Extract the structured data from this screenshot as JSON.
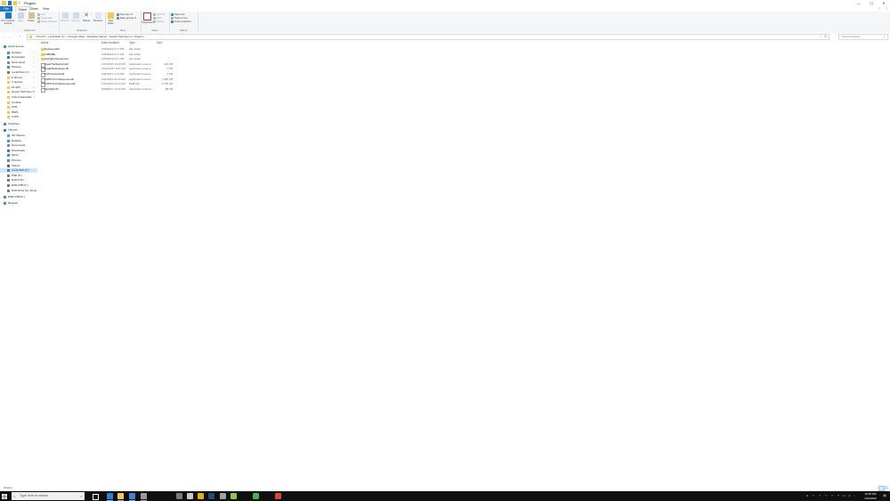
{
  "window": {
    "title": "Plugins",
    "controls": {
      "minimize": "—",
      "maximize": "☐",
      "close": "✕"
    }
  },
  "ribbon": {
    "tabs": [
      "File",
      "Home",
      "Share",
      "View"
    ],
    "clipboard": {
      "label": "Clipboard",
      "pin": "Pin to Quick access",
      "copy": "Copy",
      "paste": "Paste",
      "cut": "Cut",
      "copy_path": "Copy path",
      "paste_shortcut": "Paste shortcut"
    },
    "organize": {
      "label": "Organize",
      "move_to": "Move to",
      "copy_to": "Copy to",
      "delete": "Delete",
      "rename": "Rename"
    },
    "new": {
      "label": "New",
      "new_folder": "New folder",
      "new_item": "New item ▾",
      "easy_access": "Easy access ▾"
    },
    "open": {
      "label": "Open",
      "properties": "Properties",
      "open": "Open ▾",
      "edit": "Edit",
      "history": "History"
    },
    "select": {
      "label": "Select",
      "select_all": "Select all",
      "select_none": "Select none",
      "invert": "Invert selection"
    }
  },
  "address": {
    "breadcrumbs": [
      "This PC",
      "Local Disk (C:)",
      "Program Files",
      "Rockstar Games",
      "Grand Theft Auto V",
      "Plugins"
    ],
    "search_placeholder": "Search Plugins"
  },
  "nav": {
    "quick_access": "Quick access",
    "quick_items": [
      {
        "label": "Desktop",
        "icon": "desktop-icon",
        "color": "#3b8fd9"
      },
      {
        "label": "Downloads",
        "icon": "downloads-icon",
        "color": "#2b7bd6"
      },
      {
        "label": "Documents",
        "icon": "documents-icon",
        "color": "#8a8a8a"
      },
      {
        "label": "Pictures",
        "icon": "pictures-icon",
        "color": "#3b8fd9"
      },
      {
        "label": "Local Disk (C:)",
        "icon": "drive-icon",
        "color": "#7a7a7a"
      },
      {
        "label": "Z (Items)",
        "icon": "folder-icon",
        "color": "#f3c84e"
      },
      {
        "label": "X Games",
        "icon": "folder-icon",
        "color": "#f3c84e"
      },
      {
        "label": "Z1 (EP)",
        "icon": "folder-icon",
        "color": "#f3c84e"
      },
      {
        "label": "Grand Theft Auto V",
        "icon": "folder-icon",
        "color": "#f3c84e"
      },
      {
        "label": "Vuze Downloads",
        "icon": "folder-icon",
        "color": "#f3c84e"
      },
      {
        "label": "Combat",
        "icon": "folder-icon",
        "color": "#f3c84e"
      },
      {
        "label": "NVR",
        "icon": "folder-icon",
        "color": "#f3c84e"
      },
      {
        "label": "MWS",
        "icon": "folder-icon",
        "color": "#f3c84e"
      },
      {
        "label": "V-WS",
        "icon": "folder-icon",
        "color": "#f3c84e"
      }
    ],
    "onedrive": "OneDrive",
    "this_pc": "This PC",
    "pc_items": [
      {
        "label": "3D Objects",
        "icon": "3d-objects-icon",
        "color": "#4aa3e8"
      },
      {
        "label": "Desktop",
        "icon": "desktop-icon",
        "color": "#3b8fd9"
      },
      {
        "label": "Documents",
        "icon": "documents-icon",
        "color": "#8a8a8a"
      },
      {
        "label": "Downloads",
        "icon": "downloads-icon",
        "color": "#2b7bd6"
      },
      {
        "label": "Music",
        "icon": "music-icon",
        "color": "#3b8fd9"
      },
      {
        "label": "Pictures",
        "icon": "pictures-icon",
        "color": "#3b8fd9"
      },
      {
        "label": "Videos",
        "icon": "videos-icon",
        "color": "#5a5a8a"
      },
      {
        "label": "Local Disk (C:)",
        "icon": "drive-icon",
        "color": "#7a7a7a"
      },
      {
        "label": "SSD (D:)",
        "icon": "drive-icon",
        "color": "#7a7a7a"
      },
      {
        "label": "Hybrid (E:)",
        "icon": "drive-icon",
        "color": "#7a7a7a"
      },
      {
        "label": "ESD-USB (F:)",
        "icon": "usb-drive-icon",
        "color": "#7a7a7a"
      },
      {
        "label": "DVD Drive (H:) Temp",
        "icon": "dvd-drive-icon",
        "color": "#7a7a7a"
      }
    ],
    "usb": "ESD-USB (F:)",
    "network": "Network"
  },
  "files": {
    "columns": {
      "name": "Name",
      "date": "Date modified",
      "type": "Type",
      "size": "Size"
    },
    "rows": [
      {
        "name": "DeHumanKit",
        "date": "2/25/2019 8:17 PM",
        "type": "File folder",
        "size": "",
        "icon": "folder"
      },
      {
        "name": "LSBORE",
        "date": "2/25/2019 8:17 PM",
        "type": "File folder",
        "size": "",
        "icon": "folder"
      },
      {
        "name": "Spotlight Resources",
        "date": "2/25/2019 9:21 PM",
        "type": "File folder",
        "size": "",
        "icon": "folder"
      },
      {
        "name": "ClearTheSkyCult.dll",
        "date": "1/31/2020 10:20 PM",
        "type": "Application extens...",
        "size": "104 KB",
        "icon": "dll"
      },
      {
        "name": "HeadTileReplace.dll",
        "date": "12/31/2017 8:07 AM",
        "type": "Application extens...",
        "size": "7 KB",
        "icon": "dll"
      },
      {
        "name": "InvPoisonAdd.dll",
        "date": "2/26/2017 1:04 PM",
        "type": "Application extens...",
        "size": "3 KB",
        "icon": "dll"
      },
      {
        "name": "LSPD First Response.dll",
        "date": "3/11/2019 10:10 AM",
        "type": "Application extens...",
        "size": "7,065 KB",
        "icon": "dll"
      },
      {
        "name": "LSPD First Response.pdb",
        "date": "3/11/2019 10:10 AM",
        "type": "PDB File",
        "size": "9,720 KB",
        "icon": "pdb"
      },
      {
        "name": "Spotlight.dll",
        "date": "8/18/2017 10:10 AM",
        "type": "Application extens...",
        "size": "88 KB",
        "icon": "dll"
      }
    ]
  },
  "status": {
    "count": "9 items"
  },
  "taskbar": {
    "search_placeholder": "Type here to search",
    "apps": [
      {
        "name": "task-view-icon",
        "color": "#ffffff"
      },
      {
        "name": "edge-icon",
        "color": "#2f7fd8"
      },
      {
        "name": "file-explorer-icon",
        "color": "#f3c84e"
      },
      {
        "name": "store-icon",
        "color": "#3a86d8"
      },
      {
        "name": "mail-icon",
        "color": "#9a9a9a"
      },
      {
        "name": "app-icon-1",
        "color": "#7a7a7a"
      },
      {
        "name": "app-icon-2",
        "color": "#c8c8c8"
      },
      {
        "name": "app-icon-3",
        "color": "#e8b000"
      },
      {
        "name": "steam-icon",
        "color": "#2a4d6e"
      },
      {
        "name": "app-icon-4",
        "color": "#a0a0a0"
      },
      {
        "name": "app-icon-5",
        "color": "#8cc63f"
      },
      {
        "name": "app-icon-6",
        "color": "#4caf50"
      },
      {
        "name": "app-icon-7",
        "color": "#d24a3b"
      }
    ],
    "time": "10:05 PM",
    "date": "2/21/2020"
  },
  "colors": {
    "accent": "#1979ca",
    "folder": "#f3c84e",
    "selection": "#cce8ff"
  }
}
